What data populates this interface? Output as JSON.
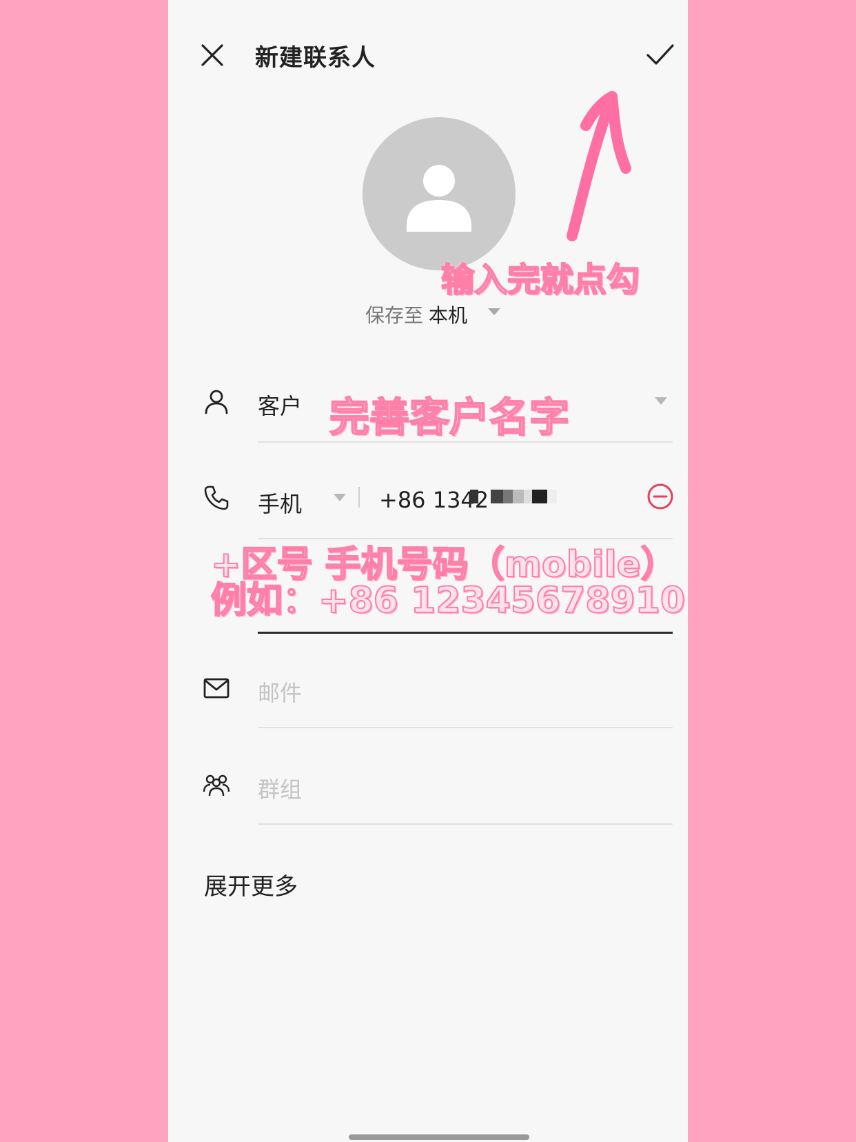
{
  "header": {
    "title": "新建联系人",
    "close_icon": "close-icon",
    "confirm_icon": "check-icon"
  },
  "avatar": {
    "icon": "person-icon"
  },
  "save_to": {
    "label": "保存至",
    "value": "本机"
  },
  "fields": {
    "name": {
      "icon": "person-outline-icon",
      "value": "客户"
    },
    "phone": {
      "icon": "phone-icon",
      "type_label": "手机",
      "value": "+86 1342"
    },
    "email": {
      "icon": "mail-icon",
      "placeholder": "邮件"
    },
    "group": {
      "icon": "group-icon",
      "placeholder": "群组"
    }
  },
  "expand_more": "展开更多",
  "annotations": {
    "tap_check": "输入完就点勾",
    "fill_name": "完善客户名字",
    "phone_hint_line1": "+区号  手机号码（mobile）",
    "phone_hint_line2": "例如：+86 12345678910"
  },
  "colors": {
    "background_pink": "#ffa3c0",
    "screen": "#f7f7f7",
    "avatar_gray": "#cbcbcb",
    "remove_red": "#e0435a",
    "annotation_pink": "#ff7fa8"
  }
}
